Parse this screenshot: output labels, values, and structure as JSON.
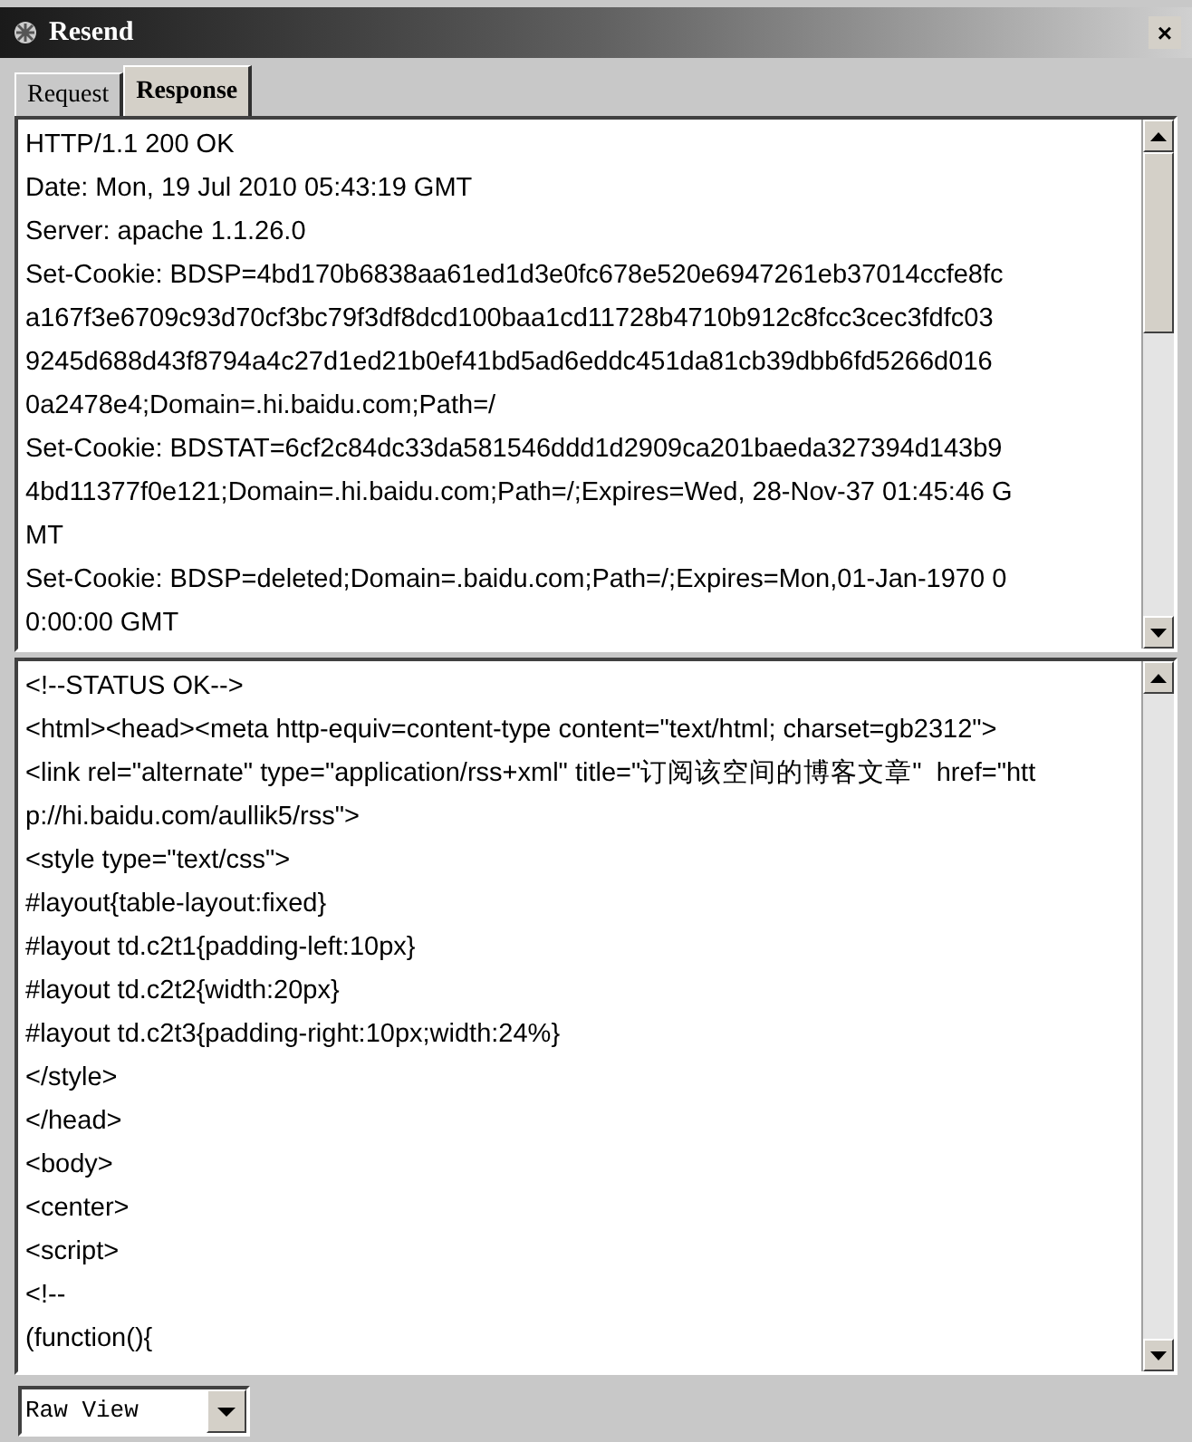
{
  "window": {
    "title": "Resend",
    "close": "×"
  },
  "tabs": [
    {
      "label": "Request",
      "selected": false
    },
    {
      "label": "Response",
      "selected": true
    }
  ],
  "headers_pane": {
    "lines": [
      "HTTP/1.1 200 OK",
      "Date: Mon, 19 Jul 2010 05:43:19 GMT",
      "Server: apache 1.1.26.0",
      "Set-Cookie: BDSP=4bd170b6838aa61ed1d3e0fc678e520e6947261eb37014ccfe8fc",
      "a167f3e6709c93d70cf3bc79f3df8dcd100baa1cd11728b4710b912c8fcc3cec3fdfc03",
      "9245d688d43f8794a4c27d1ed21b0ef41bd5ad6eddc451da81cb39dbb6fd5266d016",
      "0a2478e4;Domain=.hi.baidu.com;Path=/",
      "Set-Cookie: BDSTAT=6cf2c84dc33da581546ddd1d2909ca201baeda327394d143b9",
      "4bd11377f0e121;Domain=.hi.baidu.com;Path=/;Expires=Wed, 28-Nov-37 01:45:46 G",
      "MT",
      "Set-Cookie: BDSP=deleted;Domain=.baidu.com;Path=/;Expires=Mon,01-Jan-1970 0",
      "0:00:00 GMT"
    ]
  },
  "body_pane": {
    "lines": [
      "<!--STATUS OK-->",
      "<html><head><meta http-equiv=content-type content=\"text/html; charset=gb2312\">",
      "<link rel=\"alternate\" type=\"application/rss+xml\" title=\"订阅该空间的博客文章\"  href=\"htt",
      "p://hi.baidu.com/aullik5/rss\">",
      "<style type=\"text/css\">",
      "#layout{table-layout:fixed}",
      "#layout td.c2t1{padding-left:10px}",
      "#layout td.c2t2{width:20px}",
      "#layout td.c2t3{padding-right:10px;width:24%}",
      "</style>",
      "</head>",
      "<body>",
      "<center>",
      "<script>",
      "<!--",
      "(function(){"
    ]
  },
  "view_select": {
    "value": "Raw View"
  }
}
